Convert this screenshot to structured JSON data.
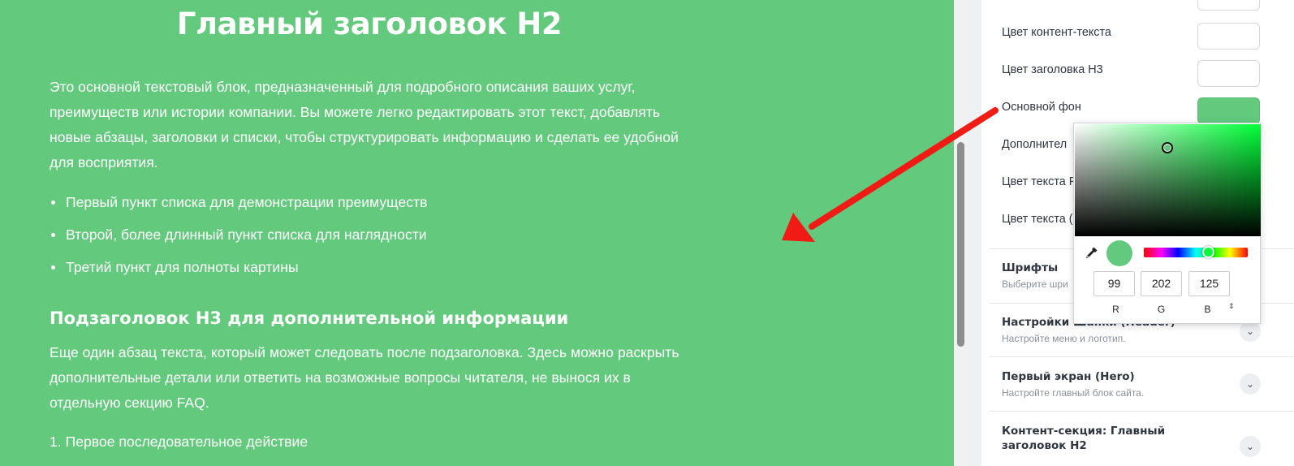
{
  "preview": {
    "heading_h2": "Главный заголовок H2",
    "paragraph_1": "Это основной текстовый блок, предназначенный для подробного описания ваших услуг, преимуществ или истории компании. Вы можете легко редактировать этот текст, добавлять новые абзацы, заголовки и списки, чтобы структурировать информацию и сделать ее удобной для восприятия.",
    "bullets": [
      "Первый пункт списка для демонстрации преимуществ",
      "Второй, более длинный пункт списка для наглядности",
      "Третий пункт для полноты картины"
    ],
    "heading_h3": "Подзаголовок H3 для дополнительной информации",
    "paragraph_2": "Еще один абзац текста, который может следовать после подзаголовка. Здесь можно раскрыть дополнительные детали или ответить на возможные вопросы читателя, не вынося их в отдельную секцию FAQ.",
    "ordered_item_1": "1. Первое последовательное действие",
    "background_color": "#63ca7d"
  },
  "panel": {
    "color_rows": [
      {
        "label": "Цвет контент-текста",
        "color": "#ffffff"
      },
      {
        "label": "Цвет заголовка H3",
        "color": "#ffffff"
      },
      {
        "label": "Основной фон",
        "color": "#63ca7d"
      },
      {
        "label": "Дополнител",
        "color": "#ffffff"
      },
      {
        "label": "Цвет текста F",
        "color": "#ffffff"
      },
      {
        "label": "Цвет текста (",
        "color": "#ffffff"
      }
    ],
    "sections": [
      {
        "title": "Шрифты",
        "subtitle": "Выберите шри"
      },
      {
        "title": "Настройки Шапки (Header)",
        "subtitle": "Настройте меню и логотип."
      },
      {
        "title": "Первый экран (Hero)",
        "subtitle": "Настройте главный блок сайта."
      },
      {
        "title": "Контент-секция: Главный заголовок H2",
        "subtitle": ""
      }
    ]
  },
  "color_picker": {
    "current_color": "#63ca7d",
    "hue_color": "#00ff38",
    "r": "99",
    "g": "202",
    "b": "125",
    "r_label": "R",
    "g_label": "G",
    "b_label": "B",
    "mode_toggle_icon": "up-down-arrows-icon"
  },
  "annotation": {
    "arrow_color": "#f01b14"
  }
}
